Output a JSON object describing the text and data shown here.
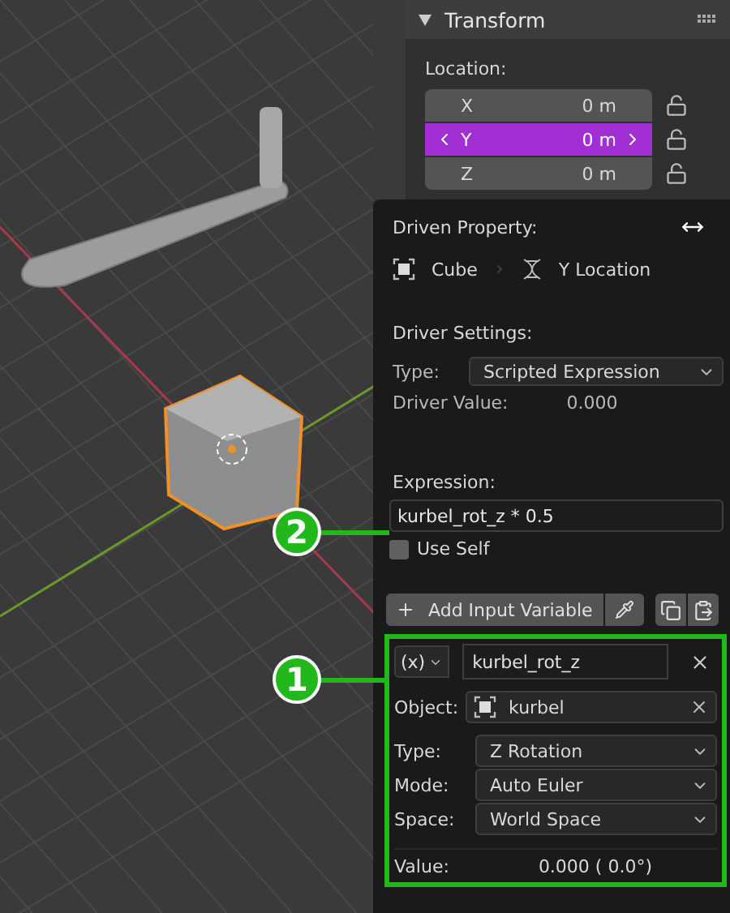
{
  "panel": {
    "title": "Transform",
    "expanded": true,
    "location_label": "Location:",
    "fields": [
      {
        "axis": "X",
        "value": "0 m",
        "selected": false,
        "locked": false
      },
      {
        "axis": "Y",
        "value": "0 m",
        "selected": true,
        "locked": false
      },
      {
        "axis": "Z",
        "value": "0 m",
        "selected": false,
        "locked": false
      }
    ]
  },
  "driver_popup": {
    "driven_property_label": "Driven Property:",
    "object": "Cube",
    "property": "Y Location",
    "settings_label": "Driver Settings:",
    "type_label": "Type:",
    "type_value": "Scripted Expression",
    "driver_value_label": "Driver Value:",
    "driver_value": "0.000",
    "expression_label": "Expression:",
    "expression": "kurbel_rot_z * 0.5",
    "use_self": {
      "label": "Use Self",
      "checked": false
    },
    "add_variable": "Add Input Variable",
    "variable": {
      "type_symbol": "(x)",
      "name": "kurbel_rot_z",
      "object_label": "Object:",
      "object": "kurbel",
      "settings": [
        {
          "label": "Type:",
          "value": "Z Rotation"
        },
        {
          "label": "Mode:",
          "value": "Auto Euler"
        },
        {
          "label": "Space:",
          "value": "World Space"
        }
      ],
      "value_label": "Value:",
      "value": "0.000 ( 0.0°)"
    }
  },
  "callouts": [
    {
      "number": "2"
    },
    {
      "number": "1"
    }
  ]
}
